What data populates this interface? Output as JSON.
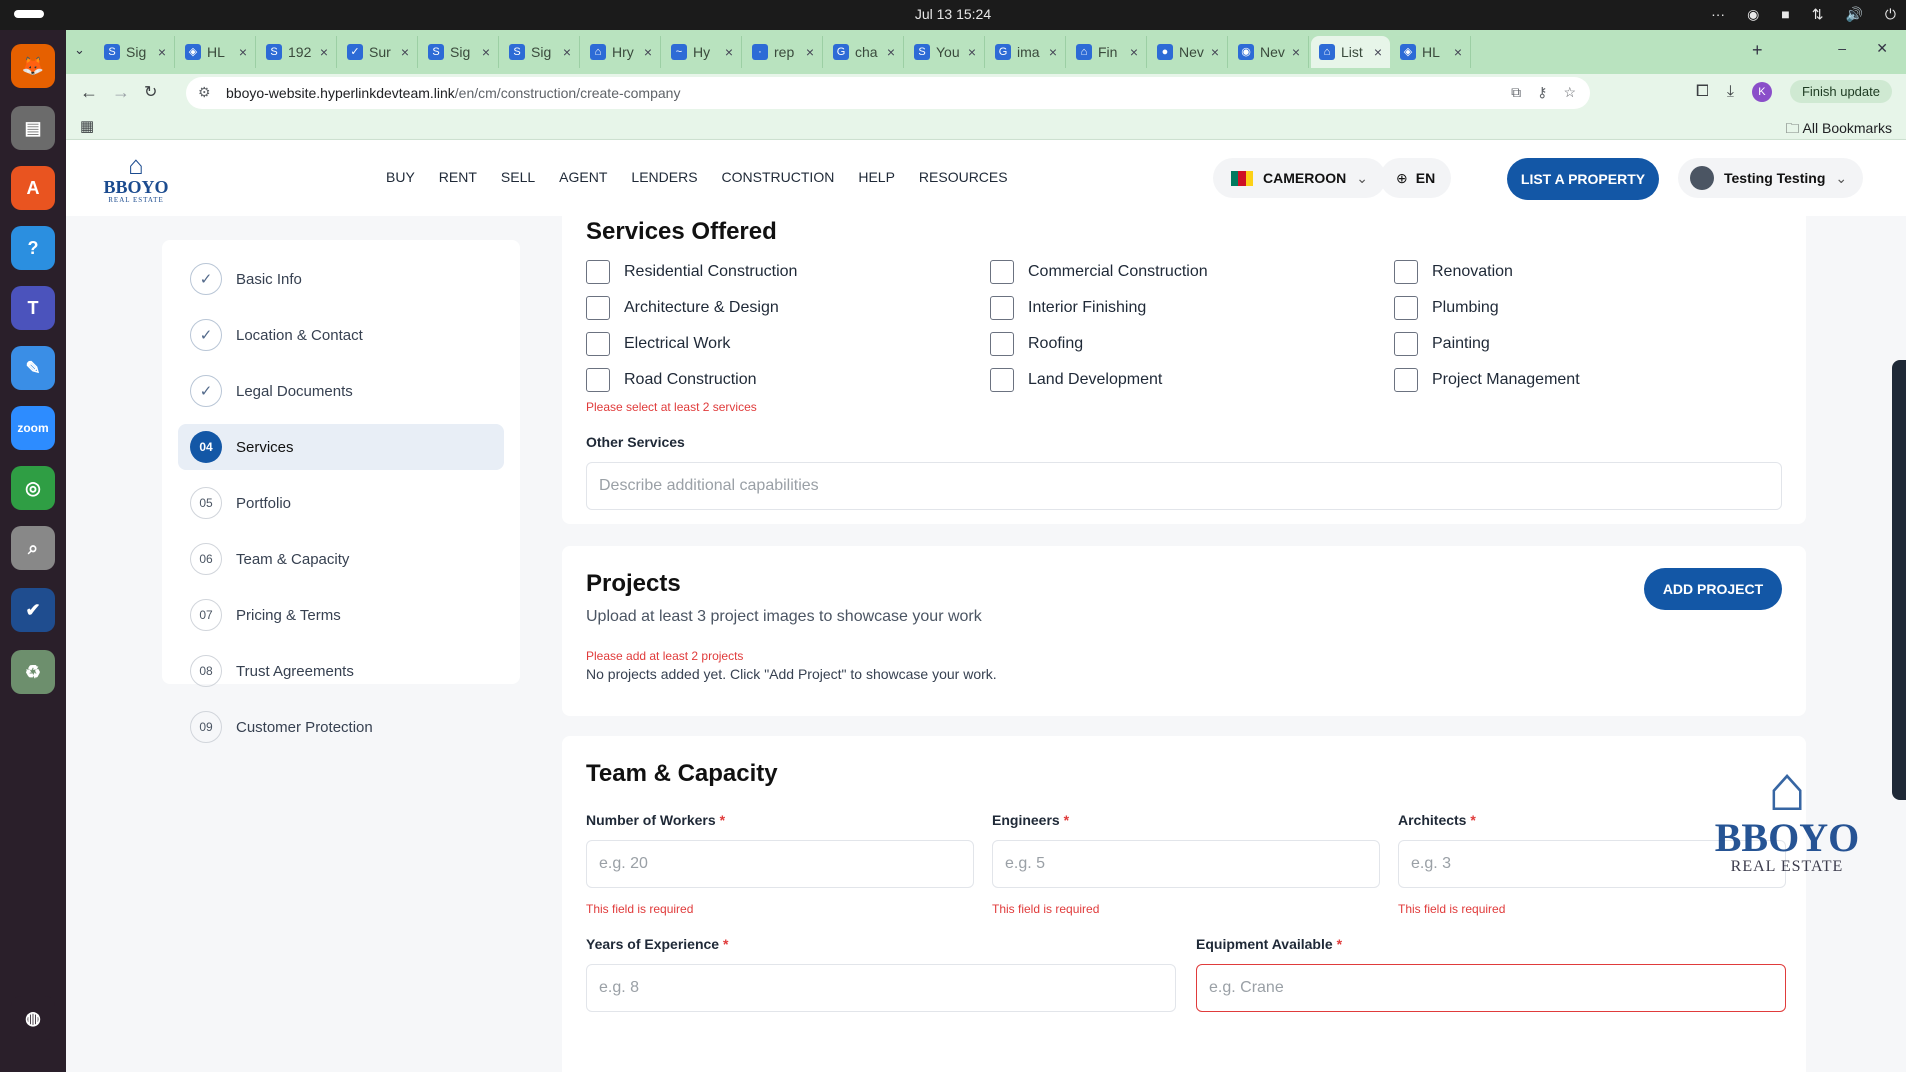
{
  "system": {
    "clock": "Jul 13  15:24",
    "tray": [
      "···",
      "◉",
      "■",
      "⇅",
      "🔊",
      "⏻"
    ]
  },
  "dock": [
    {
      "name": "firefox",
      "glyph": "🦊",
      "color": "#e66000"
    },
    {
      "name": "files",
      "glyph": "▤",
      "color": "#6b6b6b"
    },
    {
      "name": "app-center",
      "glyph": "A",
      "color": "#e95420"
    },
    {
      "name": "help",
      "glyph": "?",
      "color": "#2b8fe0"
    },
    {
      "name": "teams",
      "glyph": "T",
      "color": "#4b53bc"
    },
    {
      "name": "text-editor",
      "glyph": "✎",
      "color": "#3a8ee6"
    },
    {
      "name": "zoom",
      "glyph": "zoom",
      "color": "#2d8cff"
    },
    {
      "name": "chrome",
      "glyph": "◎",
      "color": "#2f9e44"
    },
    {
      "name": "magnifier",
      "glyph": "⌕",
      "color": "#888888"
    },
    {
      "name": "checker",
      "glyph": "✔",
      "color": "#1f4d8f"
    },
    {
      "name": "trash",
      "glyph": "♻",
      "color": "#6d8f6d"
    },
    {
      "name": "ubuntu",
      "glyph": "◍",
      "color": "#2a1f2a"
    }
  ],
  "browser": {
    "tabs": [
      {
        "label": "Sig",
        "fav": "S"
      },
      {
        "label": "HL",
        "fav": "◈"
      },
      {
        "label": "192",
        "fav": "S"
      },
      {
        "label": "Sur",
        "fav": "✓"
      },
      {
        "label": "Sig",
        "fav": "S"
      },
      {
        "label": "Sig",
        "fav": "S"
      },
      {
        "label": "Hry",
        "fav": "⌂"
      },
      {
        "label": "Hy",
        "fav": "~"
      },
      {
        "label": "rep",
        "fav": "·"
      },
      {
        "label": "cha",
        "fav": "G"
      },
      {
        "label": "You",
        "fav": "S"
      },
      {
        "label": "ima",
        "fav": "G"
      },
      {
        "label": "Fin",
        "fav": "⌂"
      },
      {
        "label": "Nev",
        "fav": "●"
      },
      {
        "label": "Nev",
        "fav": "◉"
      },
      {
        "label": "List",
        "fav": "⌂",
        "active": true
      },
      {
        "label": "HL",
        "fav": "◈"
      }
    ],
    "url_host": "bboyo-website.hyperlinkdevteam.link",
    "url_path": "/en/cm/construction/create-company",
    "finish_update": "Finish update",
    "profile_initial": "K",
    "all_bookmarks": "All Bookmarks"
  },
  "site": {
    "logo": {
      "word": "BBOYO",
      "sub": "REAL ESTATE"
    },
    "nav": [
      "BUY",
      "RENT",
      "SELL",
      "AGENT",
      "LENDERS",
      "CONSTRUCTION",
      "HELP",
      "RESOURCES"
    ],
    "country": "CAMEROON",
    "language": "EN",
    "list_property": "LIST A PROPERTY",
    "user": "Testing Testing"
  },
  "steps": [
    {
      "num": "✓",
      "label": "Basic Info",
      "state": "done"
    },
    {
      "num": "✓",
      "label": "Location & Contact",
      "state": "done"
    },
    {
      "num": "✓",
      "label": "Legal Documents",
      "state": "done"
    },
    {
      "num": "04",
      "label": "Services",
      "state": "active"
    },
    {
      "num": "05",
      "label": "Portfolio",
      "state": "todo"
    },
    {
      "num": "06",
      "label": "Team & Capacity",
      "state": "todo"
    },
    {
      "num": "07",
      "label": "Pricing & Terms",
      "state": "todo"
    },
    {
      "num": "08",
      "label": "Trust Agreements",
      "state": "todo"
    },
    {
      "num": "09",
      "label": "Customer Protection",
      "state": "todo"
    }
  ],
  "services": {
    "title": "Services Offered",
    "options": [
      "Residential Construction",
      "Commercial Construction",
      "Renovation",
      "Architecture & Design",
      "Interior Finishing",
      "Plumbing",
      "Electrical Work",
      "Roofing",
      "Painting",
      "Road Construction",
      "Land Development",
      "Project Management"
    ],
    "error": "Please select at least 2 services",
    "other_label": "Other Services",
    "other_placeholder": "Describe additional capabilities"
  },
  "projects": {
    "title": "Projects",
    "subtitle": "Upload at least 3 project images to showcase your work",
    "add_button": "ADD PROJECT",
    "error": "Please add at least 2 projects",
    "empty": "No projects added yet. Click \"Add Project\" to showcase your work."
  },
  "team": {
    "title": "Team & Capacity",
    "workers_label": "Number of Workers",
    "workers_placeholder": "e.g. 20",
    "engineers_label": "Engineers",
    "engineers_placeholder": "e.g. 5",
    "architects_label": "Architects",
    "architects_placeholder": "e.g. 3",
    "required_error": "This field is required",
    "experience_label": "Years of Experience",
    "experience_placeholder": "e.g. 8",
    "equipment_label": "Equipment Available",
    "equipment_placeholder": "e.g. Crane",
    "required_mark": "*"
  },
  "colors": {
    "primary": "#1357a6",
    "error": "#e03b3b",
    "tabstrip": "#b9e3bf"
  }
}
